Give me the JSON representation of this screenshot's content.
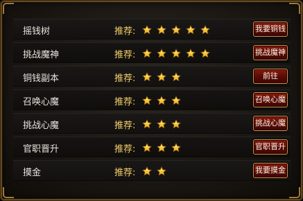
{
  "recommend_label": "推荐:",
  "rows": [
    {
      "name": "摇钱树",
      "stars": 5,
      "button": "我要铜钱"
    },
    {
      "name": "挑战魔神",
      "stars": 5,
      "button": "挑战魔神"
    },
    {
      "name": "铜钱副本",
      "stars": 3,
      "button": "前往"
    },
    {
      "name": "召唤心魔",
      "stars": 3,
      "button": "召唤心魔"
    },
    {
      "name": "挑战心魔",
      "stars": 3,
      "button": "挑战心魔"
    },
    {
      "name": "官职晋升",
      "stars": 3,
      "button": "官职晋升"
    },
    {
      "name": "摸金",
      "stars": 2,
      "button": "我要摸金"
    }
  ],
  "icons": {
    "star": "star-icon"
  },
  "colors": {
    "star": "#f5c12e",
    "button": "#6e1209",
    "label": "#f2cf68"
  }
}
